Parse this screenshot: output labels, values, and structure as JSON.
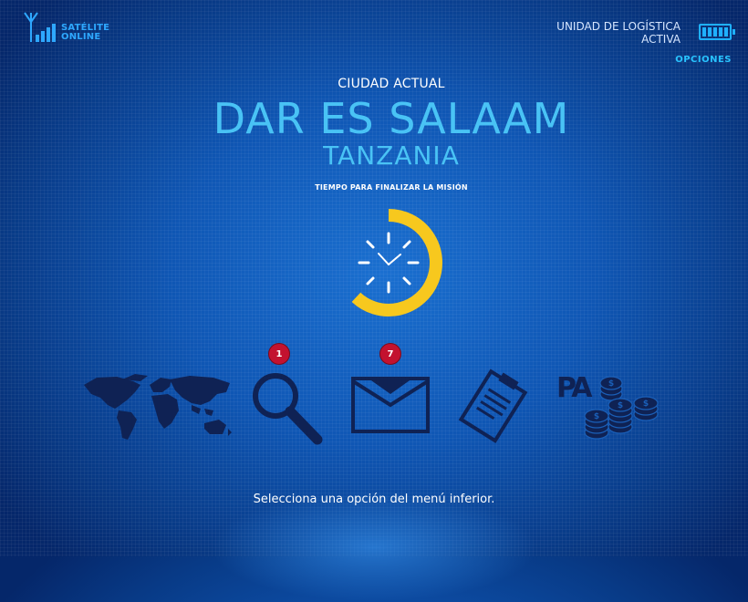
{
  "status": {
    "satellite_line1": "SATÉLITE",
    "satellite_line2": "ONLINE",
    "logistics_line1": "UNIDAD DE LOGÍSTICA",
    "logistics_line2": "ACTIVA",
    "options_label": "OPCIONES"
  },
  "location": {
    "label": "CIUDAD ACTUAL",
    "city": "DAR ES SALAAM",
    "country": "TANZANIA"
  },
  "timer": {
    "label": "TIEMPO PARA FINALIZAR LA MISIÓN",
    "remaining_fraction": 0.62,
    "color": "#f7c81e"
  },
  "menu": {
    "items": [
      {
        "name": "world-map",
        "icon": "world-map-icon"
      },
      {
        "name": "search",
        "icon": "magnifier-icon",
        "badge": "1"
      },
      {
        "name": "messages",
        "icon": "envelope-icon",
        "badge": "7"
      },
      {
        "name": "dossier",
        "icon": "clipboard-icon"
      },
      {
        "name": "funds",
        "icon": "coins-icon",
        "label": "PA"
      }
    ]
  },
  "footer": {
    "hint": "Selecciona una opción del menú inferior."
  },
  "colors": {
    "accent": "#49c3f5",
    "icon": "#0f2254",
    "badge": "#c3122f"
  }
}
